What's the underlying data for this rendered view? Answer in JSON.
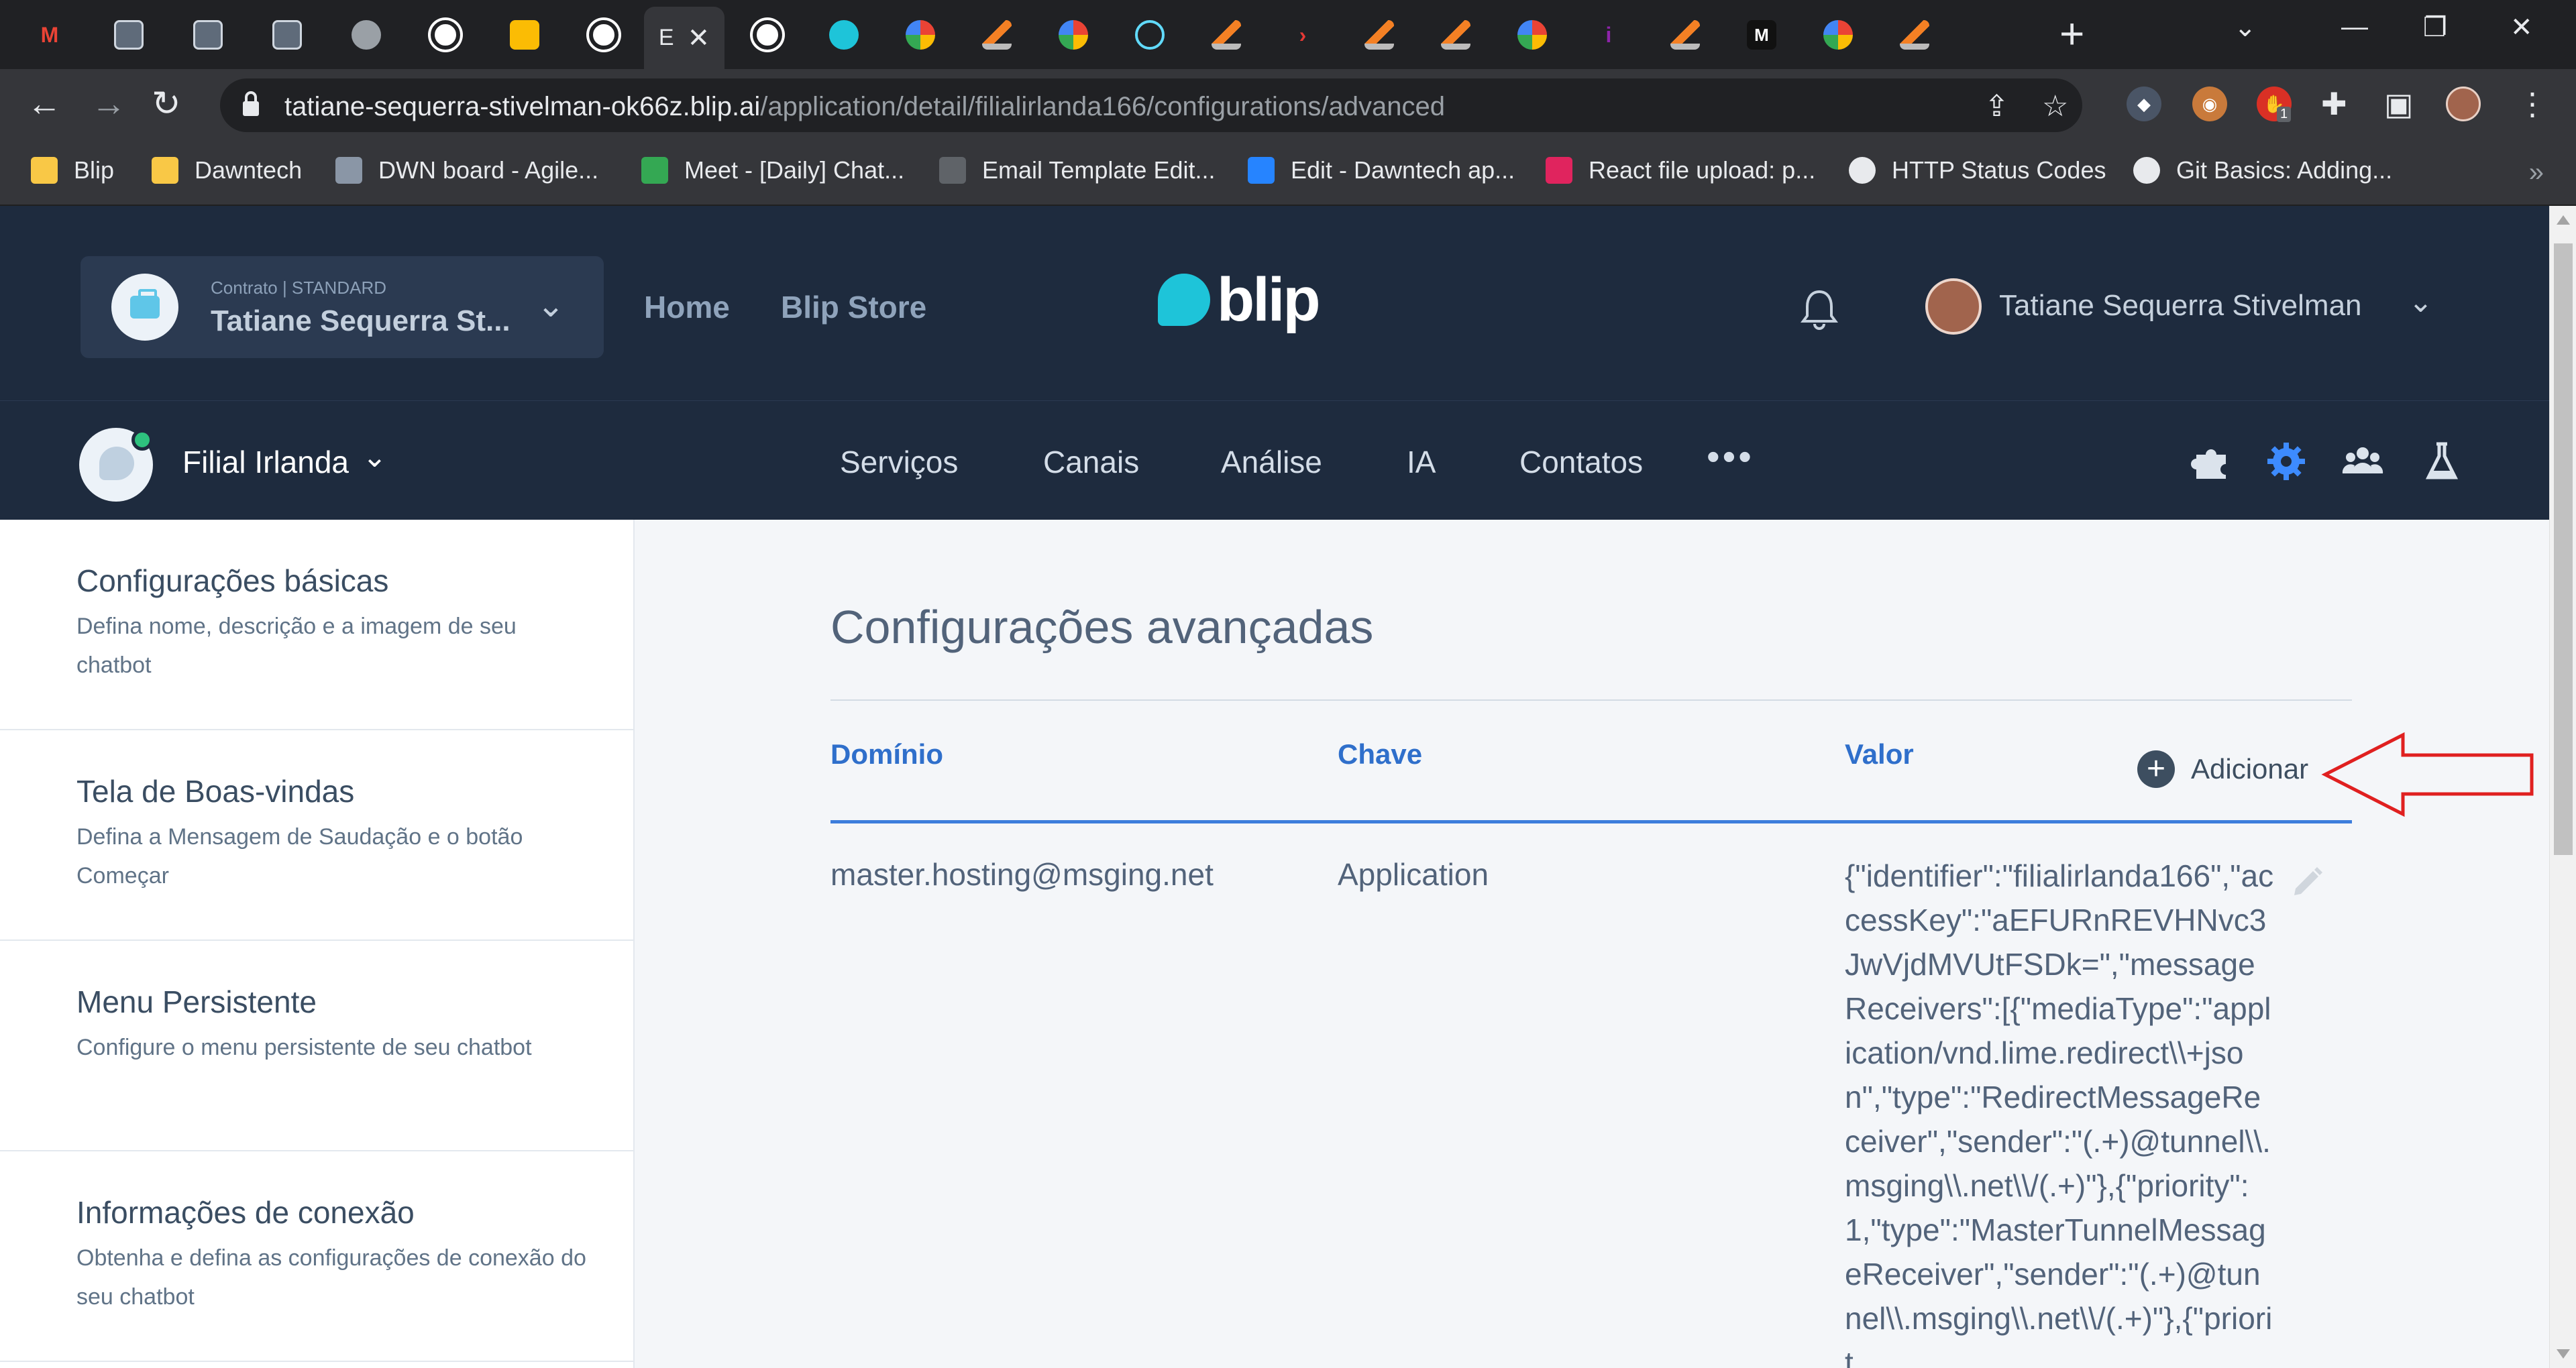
{
  "browser": {
    "active_tab_letter": "E",
    "tabs": [
      {
        "icon": "gmail-icon",
        "color": "#ea4335",
        "glyph": "M"
      },
      {
        "icon": "app-icon",
        "color": "#5f6b7a",
        "glyph": ""
      },
      {
        "icon": "app-icon",
        "color": "#5f6b7a",
        "glyph": ""
      },
      {
        "icon": "app-icon",
        "color": "#5f6b7a",
        "glyph": ""
      },
      {
        "icon": "globe-icon",
        "color": "#9aa0a6",
        "glyph": ""
      },
      {
        "icon": "github-icon",
        "color": "#ffffff",
        "glyph": ""
      },
      {
        "icon": "keep-icon",
        "color": "#fbbc04",
        "glyph": ""
      },
      {
        "icon": "github-icon",
        "color": "#ffffff",
        "glyph": ""
      }
    ],
    "tabs_right": [
      {
        "icon": "github-icon",
        "color": "#ffffff"
      },
      {
        "icon": "blip-icon",
        "color": "#1ec4d9"
      },
      {
        "icon": "google-icon",
        "color": "#ffffff"
      },
      {
        "icon": "stackoverflow-icon",
        "color": "#f48024"
      },
      {
        "icon": "google-icon",
        "color": "#ffffff"
      },
      {
        "icon": "react-icon",
        "color": "#61dafb"
      },
      {
        "icon": "stackoverflow-icon",
        "color": "#f48024"
      },
      {
        "icon": "arrow-icon",
        "color": "#e53935"
      },
      {
        "icon": "stackoverflow-icon",
        "color": "#f48024"
      },
      {
        "icon": "stackoverflow-icon",
        "color": "#f48024"
      },
      {
        "icon": "google-icon",
        "color": "#ffffff"
      },
      {
        "icon": "info-icon",
        "color": "#8e24aa"
      },
      {
        "icon": "stackoverflow-icon",
        "color": "#f48024"
      },
      {
        "icon": "m-icon",
        "color": "#ffffff"
      },
      {
        "icon": "google-icon",
        "color": "#ffffff"
      },
      {
        "icon": "stackoverflow-icon",
        "color": "#f48024"
      }
    ],
    "url_host": "tatiane-sequerra-stivelman-ok66z.blip.ai",
    "url_path": "/application/detail/filialirlanda166/configurations/advanced",
    "extension_badge": "1",
    "bookmarks": [
      {
        "label": "Blip",
        "icon": "folder-icon"
      },
      {
        "label": "Dawntech",
        "icon": "folder-icon"
      },
      {
        "label": "DWN board - Agile...",
        "icon": "app-icon"
      },
      {
        "label": "Meet - [Daily] Chat...",
        "icon": "meet-icon"
      },
      {
        "label": "Email Template Edit...",
        "icon": "template-icon"
      },
      {
        "label": "Edit - Dawntech ap...",
        "icon": "confluence-icon"
      },
      {
        "label": "React file upload: p...",
        "icon": "ruby-icon"
      },
      {
        "label": "HTTP Status Codes",
        "icon": "globe-icon"
      },
      {
        "label": "Git Basics: Adding...",
        "icon": "globe-icon"
      }
    ]
  },
  "header": {
    "contract_label": "Contrato | STANDARD",
    "contract_name": "Tatiane Sequerra St...",
    "nav": [
      "Home",
      "Blip Store"
    ],
    "logo": "blip",
    "user_name": "Tatiane Sequerra Stivelman"
  },
  "bot_nav": {
    "bot_name": "Filial Irlanda",
    "items": [
      "Serviços",
      "Canais",
      "Análise",
      "IA",
      "Contatos"
    ],
    "more": "•••"
  },
  "sidebar": {
    "items": [
      {
        "title": "Configurações básicas",
        "desc": "Defina nome, descrição e a imagem de seu chatbot"
      },
      {
        "title": "Tela de Boas-vindas",
        "desc": "Defina a Mensagem de Saudação e o botão Começar"
      },
      {
        "title": "Menu Persistente",
        "desc": "Configure o menu persistente de seu chatbot"
      },
      {
        "title": "Informações de conexão",
        "desc": "Obtenha e defina as configurações de conexão do seu chatbot"
      }
    ]
  },
  "main": {
    "title": "Configurações avançadas",
    "columns": [
      "Domínio",
      "Chave",
      "Valor"
    ],
    "add_label": "Adicionar",
    "rows": [
      {
        "domain": "master.hosting@msging.net",
        "key": "Application",
        "value": "{\"identifier\":\"filialirlanda166\",\"accessKey\":\"aEFURnREVHNvc3JwVjdMVUtFSDk=\",\"messageReceivers\":[{\"mediaType\":\"application/vnd.lime.redirect\\\\+json\",\"type\":\"RedirectMessageReceiver\",\"sender\":\"(.+)@tunnel\\\\.msging\\\\.net\\\\/(.+)\"},{\"priority\":1,\"type\":\"MasterTunnelMessageReceiver\",\"sender\":\"(.+)@tunnel\\\\.msging\\\\.net\\\\/(.+)\"},{\"priorit"
      }
    ]
  },
  "colors": {
    "header_bg": "#1e2b3e",
    "accent_blue": "#2f6fcb",
    "annotation_red": "#e02020"
  }
}
